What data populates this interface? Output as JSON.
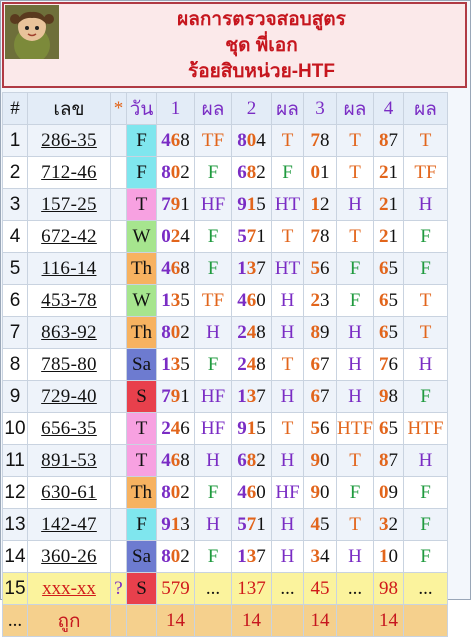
{
  "header": {
    "line1": "ผลการตรวจสอบสูตร",
    "line2": "ชุด พี่เอก",
    "line3": "ร้อยสิบหน่วย-HTF"
  },
  "columns": {
    "hash": "#",
    "set": "เลข",
    "star": "*",
    "day": "วัน",
    "n1": "1",
    "r1": "ผล",
    "n2": "2",
    "r2": "ผล",
    "n3": "3",
    "r3": "ผล",
    "n4": "4",
    "r4": "ผล"
  },
  "rows": [
    {
      "no": "1",
      "set": "286-35",
      "day": "F",
      "n1": [
        "4",
        "6",
        "8"
      ],
      "r1": "TF",
      "n2": [
        "8",
        "0",
        "4"
      ],
      "r2": "T",
      "n3": [
        "",
        "7",
        "8"
      ],
      "r3": "T",
      "n4": [
        "",
        "8",
        "7"
      ],
      "r4": "T"
    },
    {
      "no": "2",
      "set": "712-46",
      "day": "F",
      "n1": [
        "8",
        "0",
        "2"
      ],
      "r1": "F",
      "n2": [
        "6",
        "8",
        "2"
      ],
      "r2": "F",
      "n3": [
        "",
        "0",
        "1"
      ],
      "r3": "T",
      "n4": [
        "",
        "2",
        "1"
      ],
      "r4": "TF"
    },
    {
      "no": "3",
      "set": "157-25",
      "day": "T",
      "n1": [
        "7",
        "9",
        "1"
      ],
      "r1": "HF",
      "n2": [
        "9",
        "1",
        "5"
      ],
      "r2": "HT",
      "n3": [
        "",
        "1",
        "2"
      ],
      "r3": "H",
      "n4": [
        "",
        "2",
        "1"
      ],
      "r4": "H"
    },
    {
      "no": "4",
      "set": "672-42",
      "day": "W",
      "n1": [
        "0",
        "2",
        "4"
      ],
      "r1": "F",
      "n2": [
        "5",
        "7",
        "1"
      ],
      "r2": "T",
      "n3": [
        "",
        "7",
        "8"
      ],
      "r3": "T",
      "n4": [
        "",
        "2",
        "1"
      ],
      "r4": "F"
    },
    {
      "no": "5",
      "set": "116-14",
      "day": "Th",
      "n1": [
        "4",
        "6",
        "8"
      ],
      "r1": "F",
      "n2": [
        "1",
        "3",
        "7"
      ],
      "r2": "HT",
      "n3": [
        "",
        "5",
        "6"
      ],
      "r3": "F",
      "n4": [
        "",
        "6",
        "5"
      ],
      "r4": "F"
    },
    {
      "no": "6",
      "set": "453-78",
      "day": "W",
      "n1": [
        "1",
        "3",
        "5"
      ],
      "r1": "TF",
      "n2": [
        "4",
        "6",
        "0"
      ],
      "r2": "H",
      "n3": [
        "",
        "2",
        "3"
      ],
      "r3": "F",
      "n4": [
        "",
        "6",
        "5"
      ],
      "r4": "T"
    },
    {
      "no": "7",
      "set": "863-92",
      "day": "Th",
      "n1": [
        "8",
        "0",
        "2"
      ],
      "r1": "H",
      "n2": [
        "2",
        "4",
        "8"
      ],
      "r2": "H",
      "n3": [
        "",
        "8",
        "9"
      ],
      "r3": "H",
      "n4": [
        "",
        "6",
        "5"
      ],
      "r4": "T"
    },
    {
      "no": "8",
      "set": "785-80",
      "day": "Sa",
      "n1": [
        "1",
        "3",
        "5"
      ],
      "r1": "F",
      "n2": [
        "2",
        "4",
        "8"
      ],
      "r2": "T",
      "n3": [
        "",
        "6",
        "7"
      ],
      "r3": "H",
      "n4": [
        "",
        "7",
        "6"
      ],
      "r4": "H"
    },
    {
      "no": "9",
      "set": "729-40",
      "day": "S",
      "n1": [
        "7",
        "9",
        "1"
      ],
      "r1": "HF",
      "n2": [
        "1",
        "3",
        "7"
      ],
      "r2": "H",
      "n3": [
        "",
        "6",
        "7"
      ],
      "r3": "H",
      "n4": [
        "",
        "9",
        "8"
      ],
      "r4": "F"
    },
    {
      "no": "10",
      "set": "656-35",
      "day": "T",
      "n1": [
        "2",
        "4",
        "6"
      ],
      "r1": "HF",
      "n2": [
        "9",
        "1",
        "5"
      ],
      "r2": "T",
      "n3": [
        "",
        "5",
        "6"
      ],
      "r3": "HTF",
      "n4": [
        "",
        "6",
        "5"
      ],
      "r4": "HTF"
    },
    {
      "no": "11",
      "set": "891-53",
      "day": "T",
      "n1": [
        "4",
        "6",
        "8"
      ],
      "r1": "H",
      "n2": [
        "6",
        "8",
        "2"
      ],
      "r2": "H",
      "n3": [
        "",
        "9",
        "0"
      ],
      "r3": "T",
      "n4": [
        "",
        "8",
        "7"
      ],
      "r4": "H"
    },
    {
      "no": "12",
      "set": "630-61",
      "day": "Th",
      "n1": [
        "8",
        "0",
        "2"
      ],
      "r1": "F",
      "n2": [
        "4",
        "6",
        "0"
      ],
      "r2": "HF",
      "n3": [
        "",
        "9",
        "0"
      ],
      "r3": "F",
      "n4": [
        "",
        "0",
        "9"
      ],
      "r4": "F"
    },
    {
      "no": "13",
      "set": "142-47",
      "day": "F",
      "n1": [
        "9",
        "1",
        "3"
      ],
      "r1": "H",
      "n2": [
        "5",
        "7",
        "1"
      ],
      "r2": "H",
      "n3": [
        "",
        "4",
        "5"
      ],
      "r3": "T",
      "n4": [
        "",
        "3",
        "2"
      ],
      "r4": "F"
    },
    {
      "no": "14",
      "set": "360-26",
      "day": "Sa",
      "n1": [
        "8",
        "0",
        "2"
      ],
      "r1": "F",
      "n2": [
        "1",
        "3",
        "7"
      ],
      "r2": "H",
      "n3": [
        "",
        "3",
        "4"
      ],
      "r3": "H",
      "n4": [
        "",
        "1",
        "0"
      ],
      "r4": "F"
    }
  ],
  "prediction": {
    "no": "15",
    "set": "xxx-xx",
    "star": "?",
    "day": "S",
    "n1": "579",
    "r1": "...",
    "n2": "137",
    "r2": "...",
    "n3": "45",
    "r3": "...",
    "n4": "98",
    "r4": "..."
  },
  "footer": {
    "no": "...",
    "label": "ถูก",
    "c1": "14",
    "c2": "14",
    "c3": "14",
    "c4": "14"
  },
  "colors": {
    "purple": "#7a2cc4",
    "orange": "#e2651b",
    "green": "#1f9a3e",
    "red": "#c6161e"
  },
  "avatar_icon": "cartoon-girl-avatar"
}
